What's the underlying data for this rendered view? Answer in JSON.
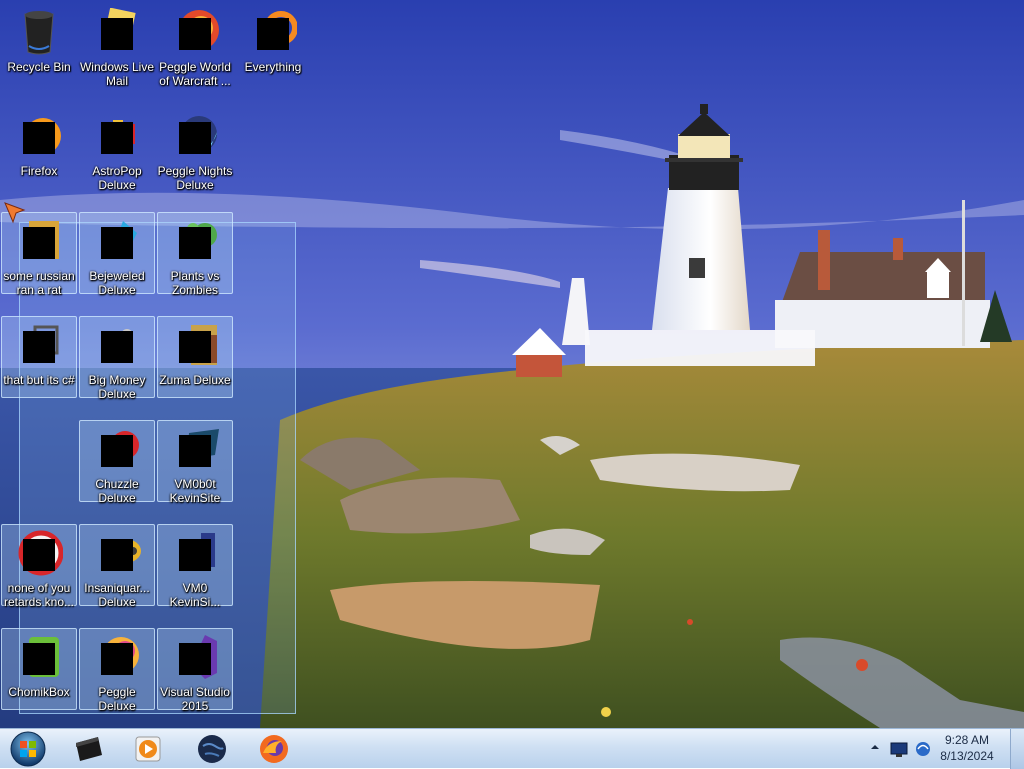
{
  "desktop": {
    "icons": [
      {
        "label": "Recycle Bin",
        "icon": "recycle-bin-icon"
      },
      {
        "label": "Windows Live Mail",
        "icon": "mail-icon"
      },
      {
        "label": "Peggle World of Warcraft ...",
        "icon": "game-icon"
      },
      {
        "label": "Everything",
        "icon": "search-icon"
      },
      {
        "label": "Firefox",
        "icon": "firefox-icon"
      },
      {
        "label": "AstroPop Deluxe",
        "icon": "game-icon"
      },
      {
        "label": "Peggle Nights Deluxe",
        "icon": "game-icon"
      },
      {
        "label": "some russian ran a rat",
        "icon": "file-icon"
      },
      {
        "label": "Bejeweled Deluxe",
        "icon": "game-icon"
      },
      {
        "label": "Plants vs Zombies",
        "icon": "game-icon"
      },
      {
        "label": "that but its c#",
        "icon": "file-icon"
      },
      {
        "label": "Big Money Deluxe",
        "icon": "game-icon"
      },
      {
        "label": "Zuma Deluxe",
        "icon": "game-icon"
      },
      {
        "label": "Chuzzle Deluxe",
        "icon": "game-icon"
      },
      {
        "label": "VM0b0t KevinSite",
        "icon": "folder-icon"
      },
      {
        "label": "none of you retards kno...",
        "icon": "file-icon"
      },
      {
        "label": "Insaniquar... Deluxe",
        "icon": "game-icon"
      },
      {
        "label": "VM0 KevinSi...",
        "icon": "folder-icon"
      },
      {
        "label": "ChomikBox",
        "icon": "app-icon"
      },
      {
        "label": "Peggle Deluxe",
        "icon": "game-icon"
      },
      {
        "label": "Visual Studio 2015",
        "icon": "visual-studio-icon"
      }
    ]
  },
  "taskbar": {
    "pinned": [
      "Windows Explorer",
      "Windows Media Player",
      "Globe",
      "Firefox"
    ],
    "clock": {
      "time": "9:28 AM",
      "date": "8/13/2024"
    }
  }
}
